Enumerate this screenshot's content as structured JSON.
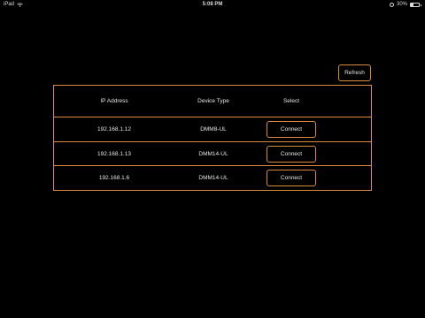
{
  "status_bar": {
    "device": "iPad",
    "time": "5:08 PM",
    "battery_text": "30%",
    "battery_level": 0.3
  },
  "toolbar": {
    "refresh_label": "Refresh"
  },
  "table": {
    "headers": {
      "ip": "IP Address",
      "device_type": "Device Type",
      "select": "Select"
    },
    "rows": [
      {
        "ip": "192.168.1.12",
        "device_type": "DMM8-UL",
        "action": "Connect"
      },
      {
        "ip": "192.168.1.13",
        "device_type": "DMM14-UL",
        "action": "Connect"
      },
      {
        "ip": "192.168.1.6",
        "device_type": "DMM14-UL",
        "action": "Connect"
      }
    ]
  },
  "colors": {
    "accent": "#d98a3a",
    "background": "#000000",
    "text": "#e6e6e6"
  }
}
